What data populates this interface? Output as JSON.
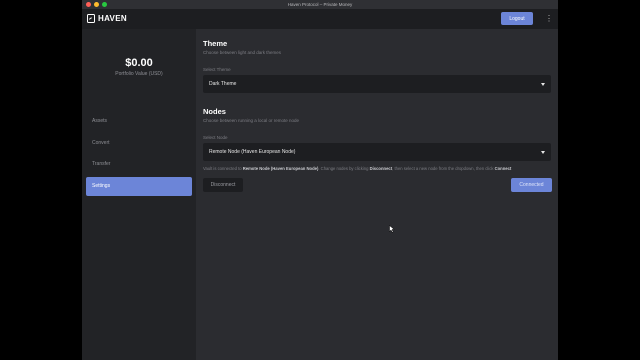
{
  "window": {
    "title": "Haven Protocol – Private Money"
  },
  "appbar": {
    "logo_text": "HAVEN",
    "logout_label": "Logout",
    "more_icon": "kebab-vertical-icon"
  },
  "sidebar": {
    "balance": "$0.00",
    "balance_label": "Portfolio Value (USD)",
    "items": [
      {
        "label": "Assets",
        "active": false
      },
      {
        "label": "Convert",
        "active": false
      },
      {
        "label": "Transfer",
        "active": false
      },
      {
        "label": "Settings",
        "active": true
      }
    ]
  },
  "theme": {
    "heading": "Theme",
    "subtitle": "Choose between light and dark themes",
    "field_label": "Select Theme",
    "selected": "Dark Theme"
  },
  "nodes": {
    "heading": "Nodes",
    "subtitle": "Choose between running a local or remote node",
    "field_label": "Select Node",
    "selected": "Remote Node (Haven European Node)",
    "info_prefix": "Vault is connected to ",
    "info_node": "Remote Node (Haven European Node)",
    "info_mid": ". Change nodes by clicking ",
    "info_disconnect": "Disconnect",
    "info_mid2": ", then select a new node from the dropdown, then click ",
    "info_connect": "Connect",
    "disconnect_label": "Disconnect",
    "connect_label": "Connected"
  },
  "colors": {
    "accent": "#6c85d8",
    "sidebar_bg": "#222326",
    "main_bg": "#2b2c30",
    "input_bg": "#1d1e21"
  }
}
